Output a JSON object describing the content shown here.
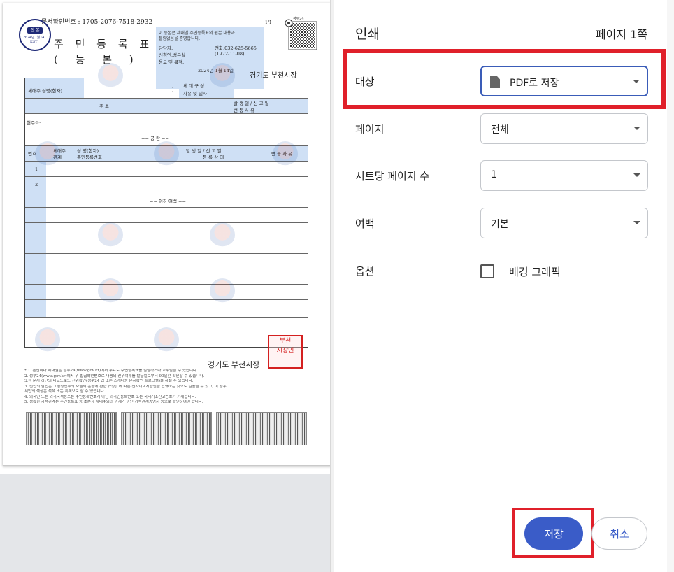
{
  "preview": {
    "doc_number": "문서확인번호 :  1705-2076-7518-2932",
    "page_indicator": "1/1",
    "seal": {
      "badge": "진 본",
      "line1": "2024년1월14",
      "line2": "KST"
    },
    "title": "주 민 등 록 표",
    "subtitle": "( 등  본 )",
    "notice": {
      "line1": "이 등본은 세대별 주민등록표의 원본 내용과",
      "line2": "틀림없음을 증명합니다.",
      "contact_label": "담당자:",
      "phone": "전화:032-625-5665",
      "applicant_label": "신청인:성은실",
      "applicant_dob": "(1972-11-08)",
      "purpose_label": "용도 및 목적:",
      "date": "2024년 1월 14일"
    },
    "qr_label": "정부24",
    "issuer": "경기도 부천시장",
    "table": {
      "head_label": "세대주 성명(한자)",
      "head_paren": ")",
      "composition_label": "세 대 구 성",
      "composition_sub": "사유 및 일자",
      "address_col": "주                소",
      "report_col_1": "발      생      일  /  신  고  일",
      "report_col_2": "변      동      사      유",
      "current_address": "현주소:",
      "public_label": "==    공    란    ==",
      "num_col": "번호",
      "relation_col_1": "세대주",
      "relation_col_2": "관계",
      "name_col": "성    명(한자)",
      "id_col": "주민등록번호",
      "reg_col_1": "발 생 일  /  신 고 일",
      "reg_col_2": "등 록 상 태",
      "change_col": "변 동 사 유",
      "row1": "1",
      "row2": "2",
      "empty_label": "== 이하 여백 =="
    },
    "stamp": "부천\n시장인",
    "footnotes": [
      "* 1. 본인이나 세대원은 정부24(www.gov.kr)에서 무료로 주민등록표를 열람하거나 교부받을 수 있습니다.",
      "   2. 정부24(www.gov.kr)에서 위 발급확인번호로 내용의 진위여부를 발급일로부터 90일간 확인할 수 있습니다.",
      "      또한 문서 하단의 바코드로도 진위확인(정부24 앱 또는 스캐너용 문서확인 프로그램)을 하실 수 있습니다.",
      "   3. 신인의 남인은 「행정업무의 효율적 운영에 관한 규정」에 따른 전자이미지관인을 인쇄하는 것으로 갈음할 수 있고, 이 경우",
      "      지인의 색상은 적색 또는 흑색으로 할 수 있습니다.",
      "   4. 외국인 또는 외국국적동포는 주민등록번호가 아닌 외국인등록번호 또는 국내거소신고번호가 기재됩니다.",
      "   5. 정확한 가족관계는 주민등록표 등·초본상 세대주와의 관계가 아닌 가족관계증명서 등으로 확인하여야 합니다."
    ]
  },
  "panel": {
    "title": "인쇄",
    "page_count": "페이지 1쪽",
    "destination": {
      "label": "대상",
      "value": "PDF로 저장"
    },
    "pages": {
      "label": "페이지",
      "value": "전체"
    },
    "pages_per_sheet": {
      "label": "시트당 페이지 수",
      "value": "1"
    },
    "margins": {
      "label": "여백",
      "value": "기본"
    },
    "options": {
      "label": "옵션",
      "checkbox_label": "배경 그래픽"
    },
    "save_label": "저장",
    "cancel_label": "취소"
  },
  "colors": {
    "accent": "#3a5cc8",
    "highlight": "#e0202a"
  }
}
